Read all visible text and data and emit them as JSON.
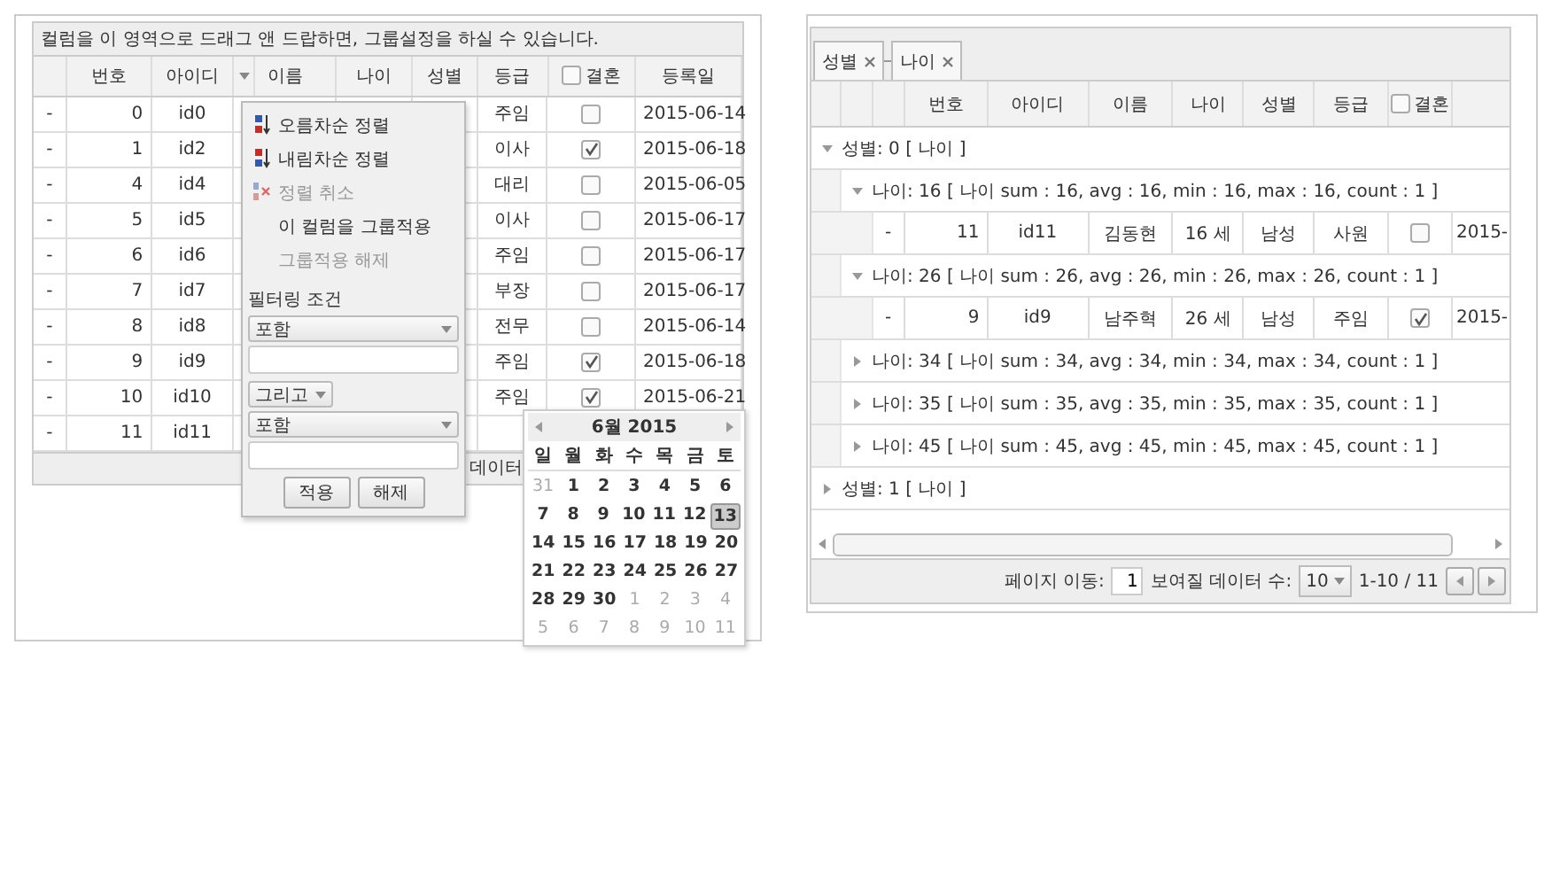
{
  "left_grid": {
    "group_hint": "컬럼을 이 영역으로 드래그 앤 드랍하면, 그룹설정을 하실 수 있습니다.",
    "columns": [
      {
        "label": "번호",
        "kind": "text",
        "has_menu": false
      },
      {
        "label": "아이디",
        "kind": "text",
        "has_menu": false
      },
      {
        "label": "이름",
        "kind": "text",
        "has_menu": true
      },
      {
        "label": "나이",
        "kind": "text",
        "has_menu": false
      },
      {
        "label": "성별",
        "kind": "text",
        "has_menu": false
      },
      {
        "label": "등급",
        "kind": "text",
        "has_menu": false
      },
      {
        "label": "결혼",
        "kind": "checkbox",
        "checked": false,
        "has_menu": false
      },
      {
        "label": "등록일",
        "kind": "text",
        "has_menu": false
      }
    ],
    "rows": [
      {
        "marker": "-",
        "number": "0",
        "id": "id0",
        "grade": "주임",
        "married": false,
        "date": "2015-06-14"
      },
      {
        "marker": "-",
        "number": "1",
        "id": "id2",
        "grade": "이사",
        "married": true,
        "date": "2015-06-18"
      },
      {
        "marker": "-",
        "number": "4",
        "id": "id4",
        "grade": "대리",
        "married": false,
        "date": "2015-06-05"
      },
      {
        "marker": "-",
        "number": "5",
        "id": "id5",
        "grade": "이사",
        "married": false,
        "date": "2015-06-17"
      },
      {
        "marker": "-",
        "number": "6",
        "id": "id6",
        "grade": "주임",
        "married": false,
        "date": "2015-06-17"
      },
      {
        "marker": "-",
        "number": "7",
        "id": "id7",
        "grade": "부장",
        "married": false,
        "date": "2015-06-17"
      },
      {
        "marker": "-",
        "number": "8",
        "id": "id8",
        "grade": "전무",
        "married": false,
        "date": "2015-06-14"
      },
      {
        "marker": "-",
        "number": "9",
        "id": "id9",
        "grade": "주임",
        "married": true,
        "date": "2015-06-18"
      },
      {
        "marker": "-",
        "number": "10",
        "id": "id10",
        "grade": "주임",
        "married": true,
        "date": "2015-06-21"
      },
      {
        "marker": "-",
        "number": "11",
        "id": "id11"
      }
    ],
    "footer_text": "데이터"
  },
  "column_menu": {
    "items": [
      {
        "label": "오름차순 정렬",
        "kind": "sort_asc",
        "disabled": false
      },
      {
        "label": "내림차순 정렬",
        "kind": "sort_desc",
        "disabled": false
      },
      {
        "label": "정렬 취소",
        "kind": "sort_clear",
        "disabled": true
      },
      {
        "label": "이 컬럼을 그룹적용",
        "kind": "plain",
        "disabled": false
      },
      {
        "label": "그룹적용 해제",
        "kind": "plain",
        "disabled": true
      }
    ],
    "filter_label": "필터링 조건",
    "condition_1": "포함",
    "operator": "그리고",
    "condition_2": "포함",
    "buttons": [
      "적용",
      "해제"
    ]
  },
  "calendar": {
    "title": "6월 2015",
    "weekdays": [
      "일",
      "월",
      "화",
      "수",
      "목",
      "금",
      "토"
    ],
    "weeks": [
      [
        {
          "day": "31",
          "other_month": true,
          "selected": false
        },
        {
          "day": "1",
          "other_month": false,
          "selected": false
        },
        {
          "day": "2",
          "other_month": false,
          "selected": false
        },
        {
          "day": "3",
          "other_month": false,
          "selected": false
        },
        {
          "day": "4",
          "other_month": false,
          "selected": false
        },
        {
          "day": "5",
          "other_month": false,
          "selected": false
        },
        {
          "day": "6",
          "other_month": false,
          "selected": false
        }
      ],
      [
        {
          "day": "7",
          "other_month": false,
          "selected": false
        },
        {
          "day": "8",
          "other_month": false,
          "selected": false
        },
        {
          "day": "9",
          "other_month": false,
          "selected": false
        },
        {
          "day": "10",
          "other_month": false,
          "selected": false
        },
        {
          "day": "11",
          "other_month": false,
          "selected": false
        },
        {
          "day": "12",
          "other_month": false,
          "selected": false
        },
        {
          "day": "13",
          "other_month": false,
          "selected": true
        }
      ],
      [
        {
          "day": "14",
          "other_month": false,
          "selected": false
        },
        {
          "day": "15",
          "other_month": false,
          "selected": false
        },
        {
          "day": "16",
          "other_month": false,
          "selected": false
        },
        {
          "day": "17",
          "other_month": false,
          "selected": false
        },
        {
          "day": "18",
          "other_month": false,
          "selected": false
        },
        {
          "day": "19",
          "other_month": false,
          "selected": false
        },
        {
          "day": "20",
          "other_month": false,
          "selected": false
        }
      ],
      [
        {
          "day": "21",
          "other_month": false,
          "selected": false
        },
        {
          "day": "22",
          "other_month": false,
          "selected": false
        },
        {
          "day": "23",
          "other_month": false,
          "selected": false
        },
        {
          "day": "24",
          "other_month": false,
          "selected": false
        },
        {
          "day": "25",
          "other_month": false,
          "selected": false
        },
        {
          "day": "26",
          "other_month": false,
          "selected": false
        },
        {
          "day": "27",
          "other_month": false,
          "selected": false
        }
      ],
      [
        {
          "day": "28",
          "other_month": false,
          "selected": false
        },
        {
          "day": "29",
          "other_month": false,
          "selected": false
        },
        {
          "day": "30",
          "other_month": false,
          "selected": false
        },
        {
          "day": "1",
          "other_month": true,
          "selected": false
        },
        {
          "day": "2",
          "other_month": true,
          "selected": false
        },
        {
          "day": "3",
          "other_month": true,
          "selected": false
        },
        {
          "day": "4",
          "other_month": true,
          "selected": false
        }
      ],
      [
        {
          "day": "5",
          "other_month": true,
          "selected": false
        },
        {
          "day": "6",
          "other_month": true,
          "selected": false
        },
        {
          "day": "7",
          "other_month": true,
          "selected": false
        },
        {
          "day": "8",
          "other_month": true,
          "selected": false
        },
        {
          "day": "9",
          "other_month": true,
          "selected": false
        },
        {
          "day": "10",
          "other_month": true,
          "selected": false
        },
        {
          "day": "11",
          "other_month": true,
          "selected": false
        }
      ]
    ]
  },
  "right_grid": {
    "group_tags": [
      "성별",
      "나이"
    ],
    "columns": [
      {
        "label": "번호",
        "kind": "text"
      },
      {
        "label": "아이디",
        "kind": "text"
      },
      {
        "label": "이름",
        "kind": "text"
      },
      {
        "label": "나이",
        "kind": "text"
      },
      {
        "label": "성별",
        "kind": "text"
      },
      {
        "label": "등급",
        "kind": "text"
      },
      {
        "label": "결혼",
        "kind": "checkbox",
        "checked": false
      }
    ],
    "groups": [
      {
        "label": "성별: 0 [ 나이 ]",
        "expanded": true,
        "children": [
          {
            "label": "나이: 16 [ 나이 sum : 16, avg : 16, min : 16, max : 16, count : 1 ]",
            "expanded": true,
            "rows": [
              {
                "marker": "-",
                "number": "11",
                "id": "id11",
                "name": "김동현",
                "age": "16 세",
                "sex": "남성",
                "grade": "사원",
                "married": false,
                "date": "2015-"
              }
            ]
          },
          {
            "label": "나이: 26 [ 나이 sum : 26, avg : 26, min : 26, max : 26, count : 1 ]",
            "expanded": true,
            "rows": [
              {
                "marker": "-",
                "number": "9",
                "id": "id9",
                "name": "남주혁",
                "age": "26 세",
                "sex": "남성",
                "grade": "주임",
                "married": true,
                "date": "2015-"
              }
            ]
          },
          {
            "label": "나이: 34 [ 나이 sum : 34, avg : 34, min : 34, max : 34, count : 1 ]",
            "expanded": false
          },
          {
            "label": "나이: 35 [ 나이 sum : 35, avg : 35, min : 35, max : 35, count : 1 ]",
            "expanded": false
          },
          {
            "label": "나이: 45 [ 나이 sum : 45, avg : 45, min : 45, max : 45, count : 1 ]",
            "expanded": false
          }
        ]
      },
      {
        "label": "성별: 1 [ 나이 ]",
        "expanded": false
      }
    ],
    "footer": {
      "page_label": "페이지 이동:",
      "page_value": "1",
      "size_label": "보여질 데이터 수:",
      "size_value": "10",
      "range": "1-10 / 11"
    }
  }
}
